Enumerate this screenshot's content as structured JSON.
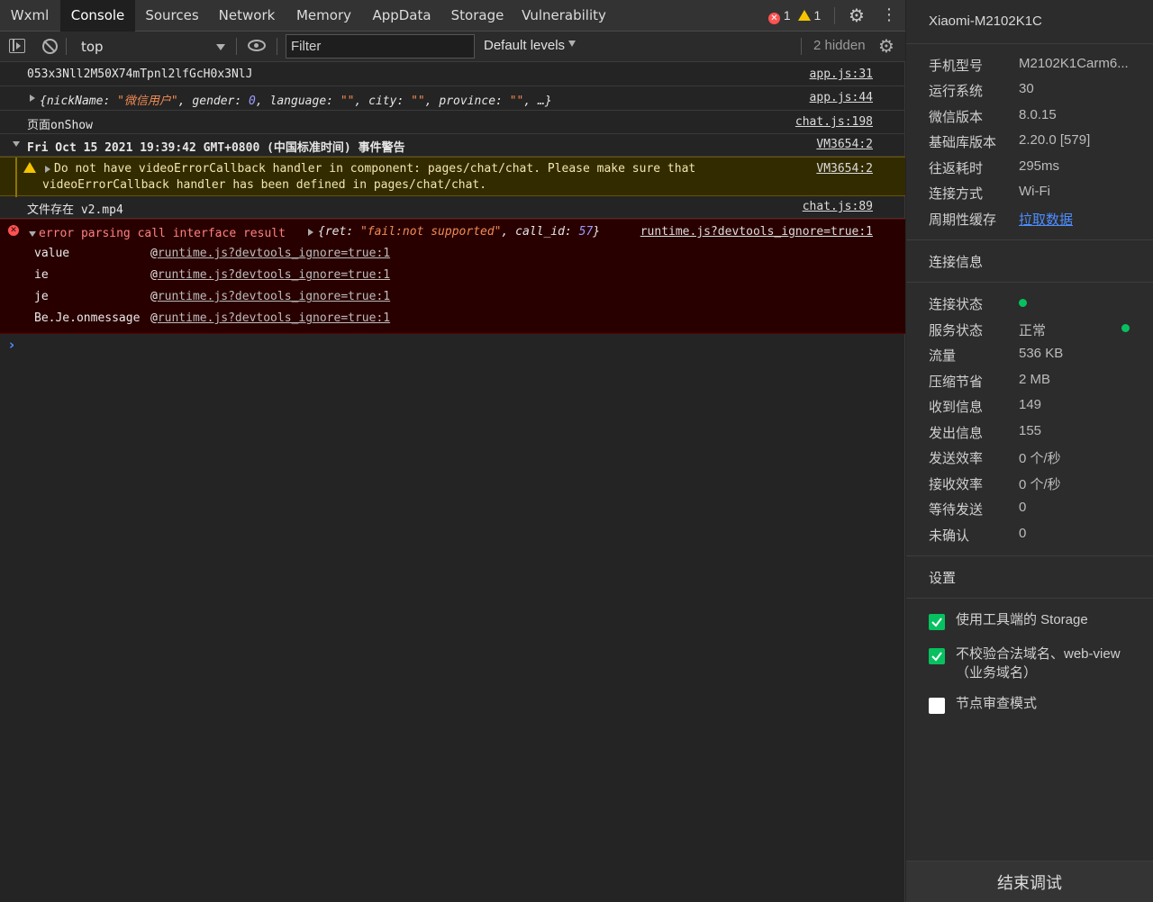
{
  "tabs": [
    {
      "label": "Wxml"
    },
    {
      "label": "Console"
    },
    {
      "label": "Sources"
    },
    {
      "label": "Network"
    },
    {
      "label": "Memory"
    },
    {
      "label": "AppData"
    },
    {
      "label": "Storage"
    },
    {
      "label": "Vulnerability"
    }
  ],
  "status": {
    "errors": "1",
    "warnings": "1"
  },
  "toolbar": {
    "context": "top",
    "filter_placeholder": "Filter",
    "levels": "Default levels",
    "hidden": "2 hidden"
  },
  "console": {
    "row1": {
      "text": "053x3Nll2M50X74mTpnl2lfGcH0x3NlJ",
      "source": "app.js:31"
    },
    "row2": {
      "open": "{",
      "k1": "nickName",
      "v1": "\"微信用户\"",
      "k2": "gender",
      "v2": "0",
      "k3": "language",
      "v3": "\"\"",
      "k4": "city",
      "v4": "\"\"",
      "k5": "province",
      "v5": "\"\"",
      "tail": ", …}",
      "source": "app.js:44"
    },
    "row3": {
      "text": "页面onShow",
      "source": "chat.js:198"
    },
    "row4": {
      "text": "Fri Oct 15 2021 19:39:42 GMT+0800 (中国标准时间) 事件警告",
      "source": "VM3654:2"
    },
    "warning": {
      "line1": "Do not have videoErrorCallback handler in component: pages/chat/chat. Please make sure that",
      "line2": "videoErrorCallback handler has been defined in pages/chat/chat.",
      "source": "VM3654:2"
    },
    "row6": {
      "text": "文件存在 v2.mp4",
      "source": "chat.js:89"
    },
    "error": {
      "message": "error parsing call interface result",
      "obj_k1": "ret",
      "obj_v1": "\"fail:not supported\"",
      "obj_k2": "call_id",
      "obj_v2": "57",
      "source": "runtime.js?devtools_ignore=true:1",
      "stack": [
        {
          "fn": "value",
          "link": "runtime.js?devtools_ignore=true:1"
        },
        {
          "fn": "ie",
          "link": "runtime.js?devtools_ignore=true:1"
        },
        {
          "fn": "je",
          "link": "runtime.js?devtools_ignore=true:1"
        },
        {
          "fn": "Be.Je.onmessage",
          "link": "runtime.js?devtools_ignore=true:1"
        }
      ]
    },
    "prompt": "›"
  },
  "side": {
    "device": "Xiaomi-M2102K1C",
    "info": [
      {
        "label": "手机型号",
        "value": "M2102K1Carm6..."
      },
      {
        "label": "运行系统",
        "value": "30"
      },
      {
        "label": "微信版本",
        "value": "8.0.15"
      },
      {
        "label": "基础库版本",
        "value": "2.20.0 [579]"
      },
      {
        "label": "往返耗时",
        "value": "295ms"
      },
      {
        "label": "连接方式",
        "value": "Wi-Fi"
      },
      {
        "label": "周期性缓存",
        "value": "拉取数据"
      }
    ],
    "conn_title": "连接信息",
    "conn": [
      {
        "label": "连接状态",
        "value": ""
      },
      {
        "label": "服务状态",
        "value": "正常"
      },
      {
        "label": "流量",
        "value": "536 KB"
      },
      {
        "label": "压缩节省",
        "value": "2 MB"
      },
      {
        "label": "收到信息",
        "value": "149"
      },
      {
        "label": "发出信息",
        "value": "155"
      },
      {
        "label": "发送效率",
        "value": "0 个/秒"
      },
      {
        "label": "接收效率",
        "value": "0 个/秒"
      },
      {
        "label": "等待发送",
        "value": "0"
      },
      {
        "label": "未确认",
        "value": "0"
      }
    ],
    "settings_title": "设置",
    "settings": [
      {
        "label": "使用工具端的 Storage",
        "checked": true
      },
      {
        "label": "不校验合法域名、web-view（业务域名）",
        "checked": true
      },
      {
        "label": "节点审查模式",
        "checked": false
      }
    ],
    "stop_label": "结束调试"
  },
  "colors": {
    "accent_green": "#07c160",
    "error_red": "#ff5252",
    "warning_yellow": "#f5c400",
    "link_blue": "#4d8dff"
  }
}
